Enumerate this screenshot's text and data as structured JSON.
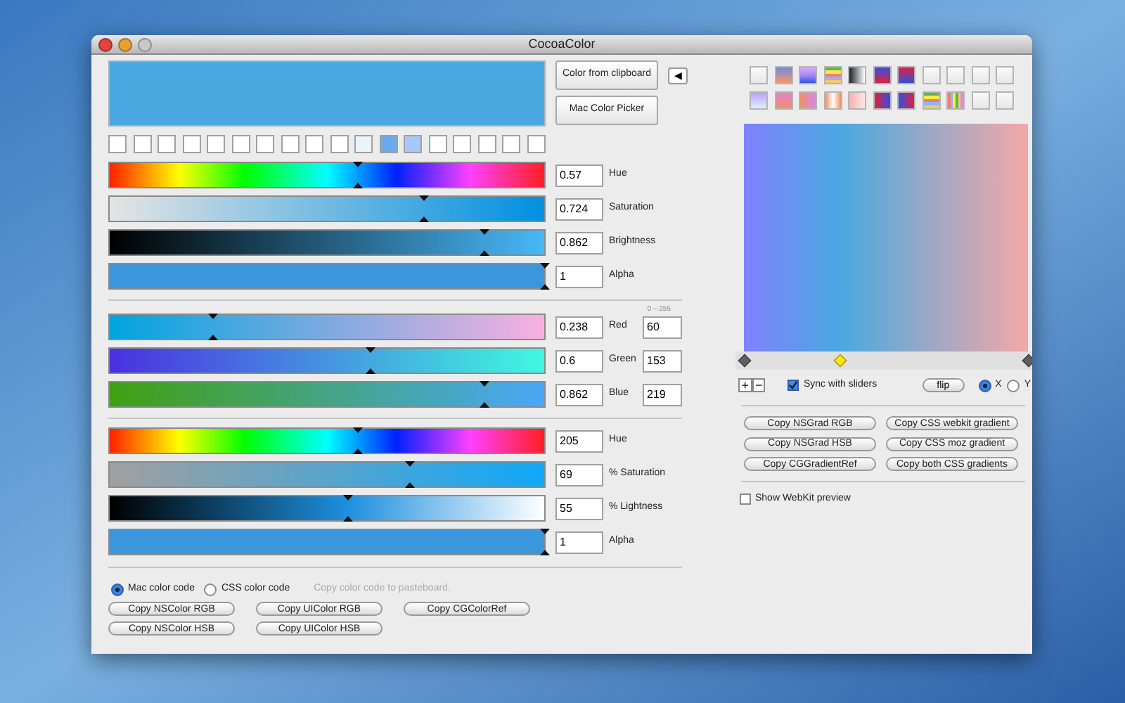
{
  "window": {
    "title": "CocoaColor"
  },
  "color_preview": {
    "color": "#4aa8e0"
  },
  "top_buttons": [
    {
      "label": "Color from clipboard"
    },
    {
      "label": "Mac Color Picker"
    }
  ],
  "arrow_button": {
    "label": "◀"
  },
  "color_wells": [
    {
      "color": "#ffffff"
    },
    {
      "color": "#ffffff"
    },
    {
      "color": "#ffffff"
    },
    {
      "color": "#ffffff"
    },
    {
      "color": "#ffffff"
    },
    {
      "color": "#ffffff"
    },
    {
      "color": "#ffffff"
    },
    {
      "color": "#ffffff"
    },
    {
      "color": "#ffffff"
    },
    {
      "color": "#ffffff"
    },
    {
      "color": "#eaf4fc"
    },
    {
      "color": "#68aaec"
    },
    {
      "color": "#a8c8fc"
    },
    {
      "color": "#ffffff"
    },
    {
      "color": "#ffffff"
    },
    {
      "color": "#ffffff"
    },
    {
      "color": "#ffffff"
    },
    {
      "color": "#ffffff"
    }
  ],
  "hsb_sliders": [
    {
      "kind": "hue",
      "level": 0.57,
      "value": "0.57",
      "label": "Hue"
    },
    {
      "kind": "saturation",
      "level": 0.724,
      "value": "0.724",
      "label": "Saturation"
    },
    {
      "kind": "brightness",
      "level": 0.862,
      "value": "0.862",
      "label": "Brightness"
    },
    {
      "kind": "alpha",
      "level": 1,
      "value": "1",
      "label": "Alpha"
    }
  ],
  "range_note": "0 – 255",
  "rgb_sliders": [
    {
      "kind": "red",
      "level": 0.238,
      "value": "0.238",
      "label": "Red",
      "int_value": "60"
    },
    {
      "kind": "green",
      "level": 0.6,
      "value": "0.6",
      "label": "Green",
      "int_value": "153"
    },
    {
      "kind": "blue",
      "level": 0.862,
      "value": "0.862",
      "label": "Blue",
      "int_value": "219"
    }
  ],
  "hsl_sliders": [
    {
      "kind": "hue",
      "level": 0.57,
      "value": "205",
      "label": "Hue"
    },
    {
      "kind": "hsl-saturation",
      "level": 0.69,
      "value": "69",
      "label": "% Saturation"
    },
    {
      "kind": "lightness",
      "level": 0.55,
      "value": "55",
      "label": "% Lightness"
    },
    {
      "kind": "alpha",
      "level": 1,
      "value": "1",
      "label": "Alpha"
    }
  ],
  "code_format": [
    {
      "label": "Mac color code",
      "selected": true
    },
    {
      "label": "CSS color code",
      "selected": false
    }
  ],
  "code_hint": "Copy color code to pasteboard.",
  "copy_buttons": [
    [
      "Copy NSColor RGB",
      "Copy UIColor RGB",
      "Copy CGColorRef"
    ],
    [
      "Copy NSColor HSB",
      "Copy UIColor HSB"
    ]
  ],
  "gradient_presets": [
    [
      {
        "kind": "blank"
      },
      {
        "kind": "p1"
      },
      {
        "kind": "p2"
      },
      {
        "kind": "p3"
      },
      {
        "kind": "p4"
      },
      {
        "kind": "p5"
      },
      {
        "kind": "p6"
      },
      {
        "kind": "blank"
      },
      {
        "kind": "blank"
      },
      {
        "kind": "blank"
      },
      {
        "kind": "blank"
      }
    ],
    [
      {
        "kind": "p7"
      },
      {
        "kind": "p8"
      },
      {
        "kind": "p9"
      },
      {
        "kind": "p10"
      },
      {
        "kind": "p11"
      },
      {
        "kind": "p12"
      },
      {
        "kind": "p13"
      },
      {
        "kind": "p3"
      },
      {
        "kind": "p14"
      },
      {
        "kind": "blank"
      },
      {
        "kind": "blank"
      }
    ]
  ],
  "gradient_stops": [
    {
      "color": "#8080ff",
      "level": 0,
      "selected": false
    },
    {
      "color": "#4aa8e0",
      "level": 0.34,
      "selected": true
    },
    {
      "color": "#f4a8a8",
      "level": 1,
      "selected": false
    }
  ],
  "stop_buttons": [
    {
      "label": "+"
    },
    {
      "label": "−"
    }
  ],
  "sync_with_sliders": {
    "label": "Sync with sliders",
    "checked": true
  },
  "flip_button": {
    "label": "flip"
  },
  "axis": [
    {
      "label": "X",
      "selected": true
    },
    {
      "label": "Y",
      "selected": false
    }
  ],
  "gradient_buttons": [
    [
      "Copy NSGrad RGB",
      "Copy CSS webkit gradient"
    ],
    [
      "Copy NSGrad HSB",
      "Copy CSS moz gradient"
    ],
    [
      "Copy CGGradientRef",
      "Copy both CSS gradients"
    ]
  ],
  "show_webkit_preview": {
    "label": "Show WebKit preview",
    "checked": false
  }
}
